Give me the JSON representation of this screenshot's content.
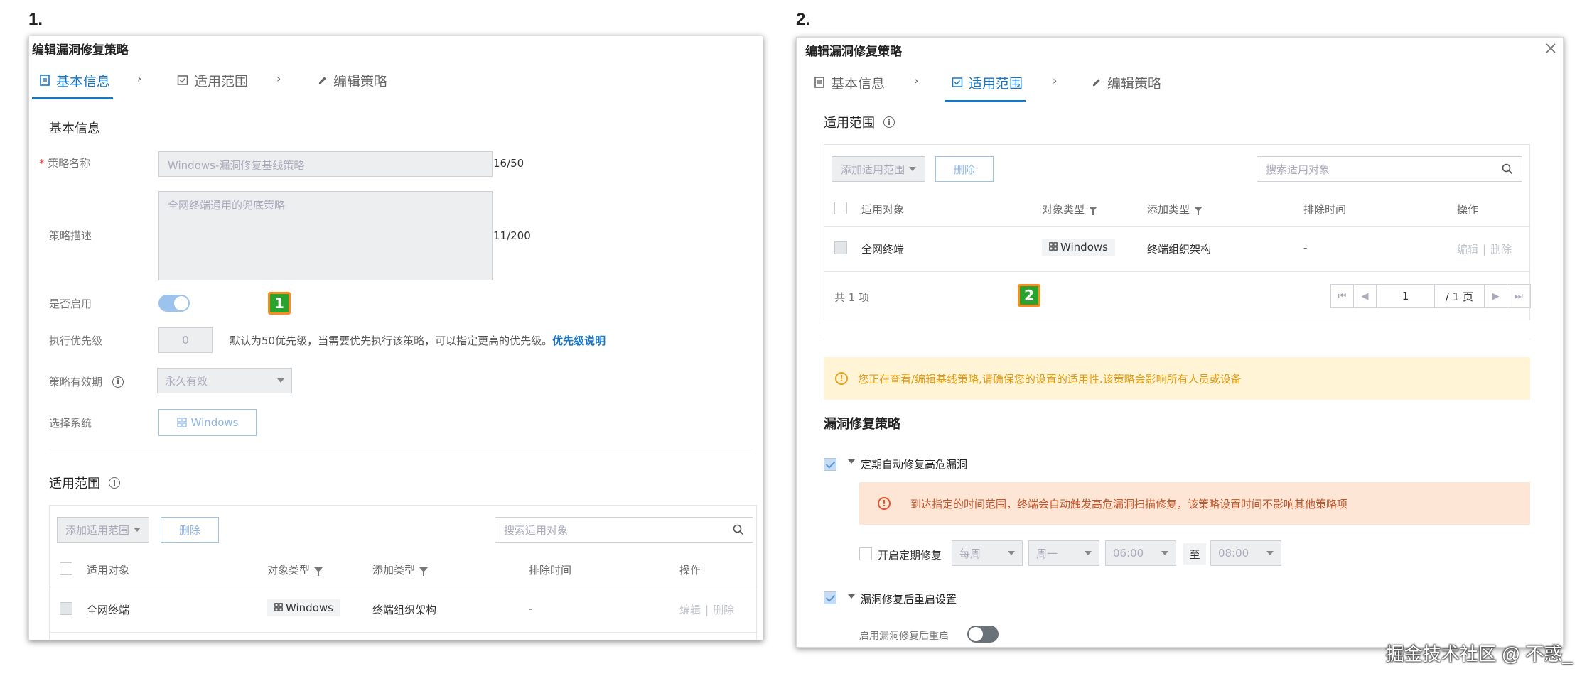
{
  "steps": [
    "1.",
    "2."
  ],
  "watermark": "掘金技术社区 @ 不惑_",
  "tabs": {
    "basic": "基本信息",
    "scope": "适用范围",
    "policy": "编辑策略"
  },
  "dialog_title": "编辑漏洞修复策略",
  "panel1": {
    "section_basic": "基本信息",
    "name_label": "策略名称",
    "name_value": "Windows-漏洞修复基线策略",
    "name_counter": "16/50",
    "desc_label": "策略描述",
    "desc_value": "全网终端通用的兜底策略",
    "desc_counter": "11/200",
    "enable_label": "是否启用",
    "priority_label": "执行优先级",
    "priority_value": "0",
    "priority_hint": "默认为50优先级，当需要优先执行该策略，可以指定更高的优先级。",
    "priority_link": "优先级说明",
    "validity_label": "策略有效期",
    "validity_value": "永久有效",
    "system_label": "选择系统",
    "system_value": "Windows",
    "scope_title": "适用范围",
    "marker": "1"
  },
  "panel2": {
    "scope_title": "适用范围",
    "pagination": {
      "total": "共 1 项",
      "page": "1",
      "pages": "/ 1 页"
    },
    "marker": "2",
    "banner_warning": "您正在查看/编辑基线策略,请确保您的设置的适用性.该策略会影响所有人员或设备",
    "policy_title": "漏洞修复策略",
    "auto_fix_label": "定期自动修复高危漏洞",
    "auto_fix_hint": "到达指定的时间范围，终端会自动触发高危漏洞扫描修复，该策略设置时间不影响其他策略项",
    "schedule_label": "开启定期修复",
    "schedule": {
      "freq": "每周",
      "day": "周一",
      "start": "06:00",
      "to": "至",
      "end": "08:00"
    },
    "reboot_label": "漏洞修复后重启设置",
    "reboot_toggle_label": "启用漏洞修复后重启"
  },
  "table": {
    "add_button": "添加适用范围",
    "delete_button": "删除",
    "search_placeholder": "搜索适用对象",
    "headers": {
      "object": "适用对象",
      "type": "对象类型",
      "add_type": "添加类型",
      "exclude_time": "排除时间",
      "ops": "操作"
    },
    "row": {
      "object": "全网终端",
      "type": "Windows",
      "add_type": "终端组织架构",
      "exclude_time": "-",
      "edit": "编辑",
      "delete": "删除"
    }
  },
  "colors": {
    "accent": "#1677c9",
    "marker_green": "#29a32d",
    "marker_border": "#ff8a1f",
    "warn_bg": "#fff4d6",
    "alert_bg": "#fde6d5"
  }
}
